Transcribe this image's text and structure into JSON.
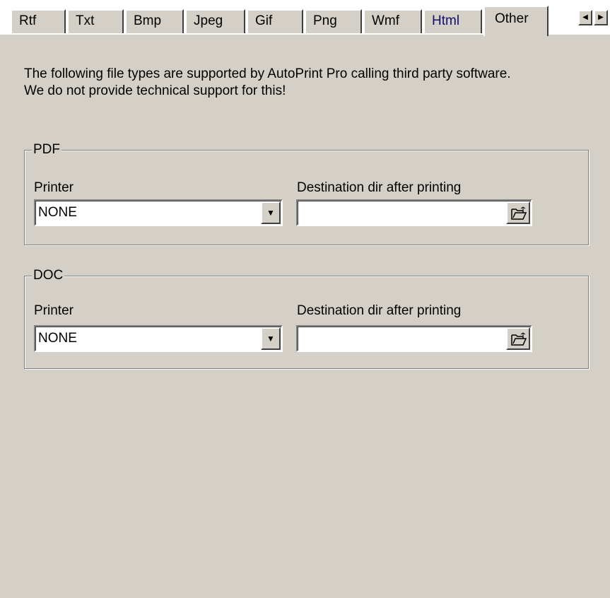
{
  "tabs": [
    {
      "label": "Rtf"
    },
    {
      "label": "Txt"
    },
    {
      "label": "Bmp"
    },
    {
      "label": "Jpeg"
    },
    {
      "label": "Gif"
    },
    {
      "label": "Png"
    },
    {
      "label": "Wmf"
    },
    {
      "label": "Html"
    },
    {
      "label": "Other"
    }
  ],
  "active_tab": "Other",
  "tab_scroll": {
    "left_icon": "arrow-left-icon",
    "right_icon": "arrow-right-icon"
  },
  "intro": {
    "line1": "The following file types are supported by AutoPrint Pro calling third party software.",
    "line2": "We do not provide technical support for this!"
  },
  "groups": {
    "pdf": {
      "title": "PDF",
      "printer_label": "Printer",
      "printer_value": "NONE",
      "dest_label": "Destination dir after printing",
      "dest_value": "",
      "browse_icon": "folder-open-icon"
    },
    "doc": {
      "title": "DOC",
      "printer_label": "Printer",
      "printer_value": "NONE",
      "dest_label": "Destination dir after printing",
      "dest_value": "",
      "browse_icon": "folder-open-icon"
    }
  },
  "colors": {
    "face": "#d4d0c8",
    "link_tab": "#10106a"
  }
}
